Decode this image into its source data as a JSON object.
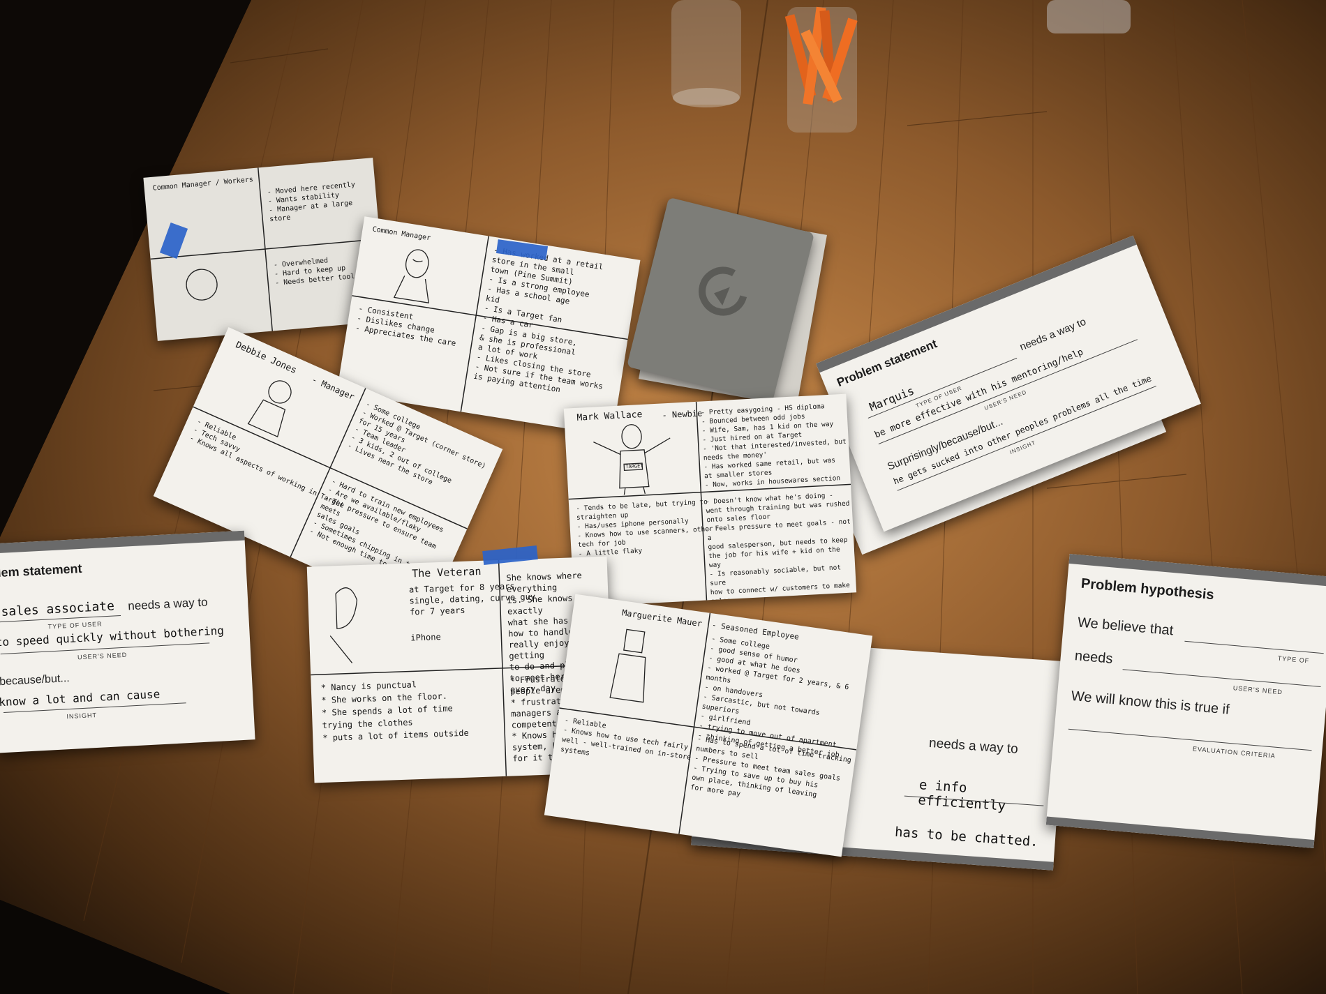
{
  "table": {
    "wood_color": "#8a5a30",
    "wood_dark": "#3a2410",
    "tape_color": "#2b63c9"
  },
  "problem_statement_left": {
    "title": "lem statement",
    "user_type_value": "sales associate",
    "needs_text": "needs a way to",
    "type_of_user_label": "TYPE OF USER",
    "need_value": "to speed quickly without bothering",
    "users_need_label": "USER'S NEED",
    "because_text": "/because/but...",
    "insight_value": "know a lot and can cause",
    "insight_label": "INSIGHT"
  },
  "problem_statement_right": {
    "title": "Problem statement",
    "user_type_value": "Marquis",
    "needs_text": "needs a way to",
    "type_of_user_label": "TYPE OF USER",
    "need_value": "be more effective with his mentoring/help",
    "users_need_label": "USER'S NEED",
    "because_text": "Surprisingly/because/but...",
    "insight_value": "he gets sucked into other peoples problems all the time",
    "insight_label": "INSIGHT"
  },
  "problem_statement_bottom": {
    "needs_text": "needs a way to",
    "need_value": "e info efficiently",
    "insight_value": "has to be chatted."
  },
  "problem_hypothesis": {
    "title": "Problem hypothesis",
    "line1": "We believe that",
    "line2": "needs",
    "type_label": "TYPE OF",
    "users_need_label": "USER'S NEED",
    "line3": "We will know this is true if",
    "eval_label": "EVALUATION CRITERIA"
  },
  "persona_mark": {
    "name": "Mark Wallace",
    "role": "- Newbie",
    "badge": "TARGET",
    "facts": "- Pretty easygoing  - HS diploma\n- Bounced between odd jobs\n- Wife, Sam, has 1 kid on the way\n- Just hired on at Target\n- 'Not that interested/invested, but\n  needs the money'\n- Has worked same retail, but was\n  at smaller stores\n- Now, works in housewares section",
    "behaviors": "- Tends to be late, but trying to\n  straighten up\n- Has/uses iphone personally\n- Knows how to use scanners, other\n  tech for job\n- A little flaky",
    "needs": "- Doesn't know what he's doing -\n  went through training but was rushed\n  onto sales floor\n- Feels pressure to meet goals - not a\n  good salesperson, but needs to keep\n  the job for his wife + kid on the way\n- Is reasonably sociable, but not sure\n  how to connect w/ customers to make\n  sales"
  },
  "persona_debbie": {
    "name": "Debbie Jones",
    "role": "- Manager",
    "facts": "- Some college\n- Worked @ Target (corner store)\n  for 15 years\n- Team leader\n- 3 kids, 2 out of college\n- Lives near the store",
    "behaviors": "- Reliable\n- Tech savvy\n- Knows all aspects of working in Target",
    "needs": "- Hard to train new employees\n- Are we available/flaky\n- The pressure to ensure team meets\n  sales goals\n- Sometimes chipping in to help\n- Not enough time to finish things"
  },
  "persona_top_left": {
    "header": "Common Manager / Workers",
    "facts": "- Moved here recently\n- Wants stability\n- Manager at a large store",
    "needs": "- Overwhelmed\n- Hard to keep up\n- Needs better tools"
  },
  "persona_top_mid": {
    "name": "Common Manager",
    "facts": "- Has worked at a retail\n  store in the small\n  town (Pine Summit)\n- Is a strong employee\n- Has a school age\n  kid\n- Is a Target fan\n- Has a car",
    "behaviors": "- Consistent\n- Dislikes change\n- Appreciates the care",
    "needs": "- Gap is a big store,\n  & she is professional\n  a lot of work\n- Likes closing the store\n- Not sure if the team works\n  is paying attention"
  },
  "persona_veteran": {
    "name": "The Veteran",
    "facts": "at Target for 8 years\n  single, dating, curve guy\n  for 7 years",
    "behaviors": "iPhone",
    "needs": "She knows where everything\n  is. She knows exactly\n  what she has to do\n  how to handle people\n  really enjoys getting\n  to do and plan\n  to meet her goals\n  every day",
    "notes": "* Nancy is punctual\n* She works on the floor.\n* She spends a lot of time\n  trying the clothes\n* puts a lot of items outside",
    "notes2": "* Frustrated that\n  people aren't\n* frustrated that\n  managers are\n  competent\n* Knows how\n  system, but\n  for it too."
  },
  "persona_marguerite": {
    "name": "Marguerite Mauer",
    "role": "- Seasoned Employee",
    "facts": "- Some college\n- good sense of humor\n- good at what he does\n- worked @ Target for 2 years, & 6 months\n- on handovers\n- Sarcastic, but not towards superiors\n- girlfriend\n- trying to move out of apartment\n- thinking of getting a better job",
    "behaviors": "- Reliable\n- Knows how to use tech fairly\n  well - well-trained on in-store\n  systems",
    "needs": "- Has to spend a lot of time tracking\n  numbers to sell\n- Pressure to meet team sales goals\n- Trying to save up to buy his\n  own place, thinking of leaving\n  for more pay"
  }
}
